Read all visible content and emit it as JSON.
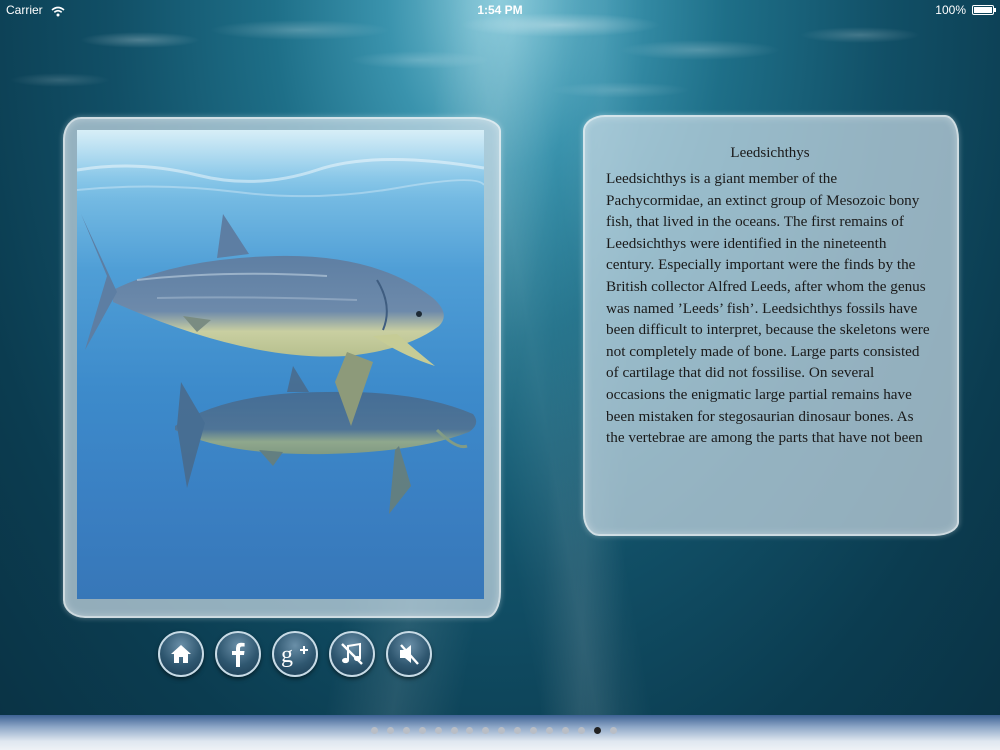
{
  "status_bar": {
    "carrier": "Carrier",
    "time": "1:54 PM",
    "battery": "100%"
  },
  "article": {
    "title": "Leedsichthys",
    "text": "Leedsichthys is a giant member of the Pachycormidae, an extinct group of Mesozoic bony fish, that lived in the oceans. The first remains of Leedsichthys were identified in the nineteenth century. Especially important were the finds by the British collector Alfred Leeds, after whom the genus was named ’Leeds’ fish’. Leedsichthys fossils have been difficult to interpret, because the skeletons were not completely made of bone. Large parts consisted of cartilage that did not fossilise. On several occasions the enigmatic large partial remains have been mistaken for stegosaurian dinosaur bones. As the vertebrae are among the parts that have not been"
  },
  "buttons": [
    {
      "icon": "home-icon"
    },
    {
      "icon": "facebook-icon"
    },
    {
      "icon": "google-plus-icon"
    },
    {
      "icon": "music-off-icon"
    },
    {
      "icon": "sound-off-icon"
    }
  ],
  "pagination": {
    "total_pages": 16,
    "current_page": 15
  },
  "colors": {
    "frame": "#c8dae4",
    "button_border": "#c8dbe6",
    "active_dot": "#222222"
  }
}
